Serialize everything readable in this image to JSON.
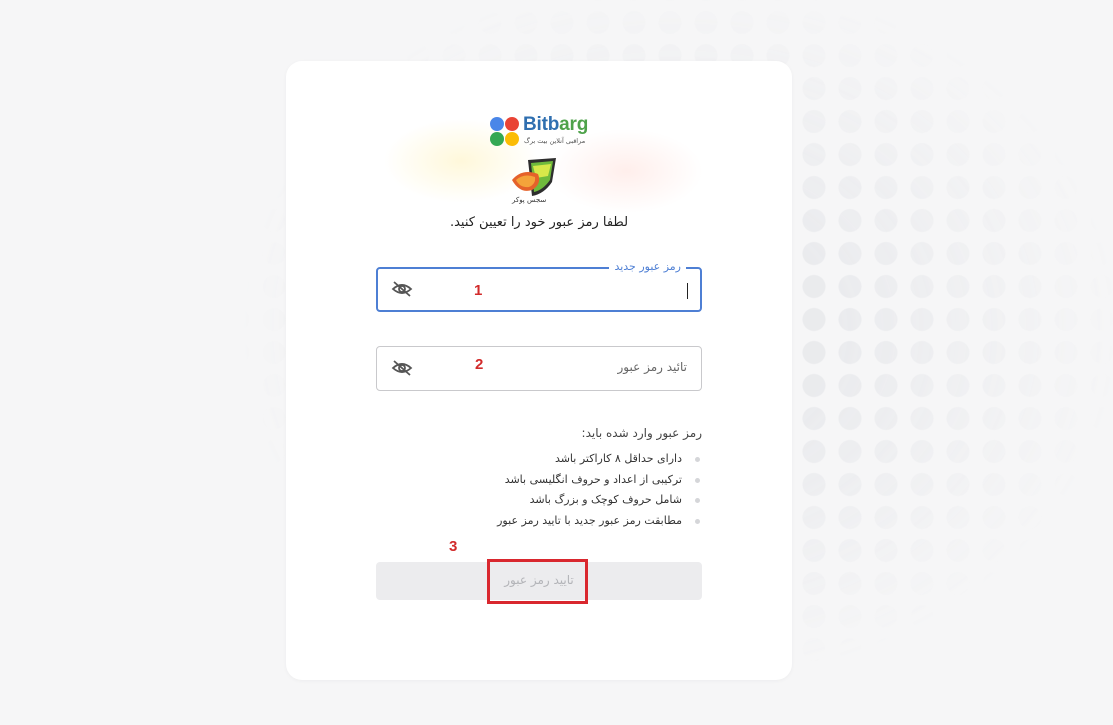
{
  "brand": {
    "name_blue": "Bitb",
    "name_green": "arg",
    "tagline": "مراقبی آنلاین بیت برگ"
  },
  "product": {
    "label": "سجس پوکر"
  },
  "instruction": "لطفا رمز عبور خود را تعیین کنید.",
  "fields": {
    "new_password": {
      "label": "رمز عبور جدید",
      "value": ""
    },
    "confirm_password": {
      "placeholder": "تائید رمز عبور",
      "value": ""
    }
  },
  "rules": {
    "title": "رمز عبور وارد شده باید:",
    "items": [
      "دارای حداقل ۸ کاراکتر باشد",
      "ترکیبی از اعداد و حروف انگلیسی باشد",
      "شامل حروف کوچک و بزرگ باشد",
      "مطابقت رمز عبور جدید با تایید رمز عبور"
    ]
  },
  "submit": {
    "label": "تایید رمز عبور",
    "enabled": false
  },
  "annotations": {
    "m1": "1",
    "m2": "2",
    "m3": "3"
  },
  "colors": {
    "accent": "#4e7fd4",
    "annotation": "#d22b2b",
    "disabled_bg": "#ececee",
    "disabled_text": "#b3b4b8"
  },
  "icons": {
    "visibility_toggle": "eye-slash-icon"
  }
}
